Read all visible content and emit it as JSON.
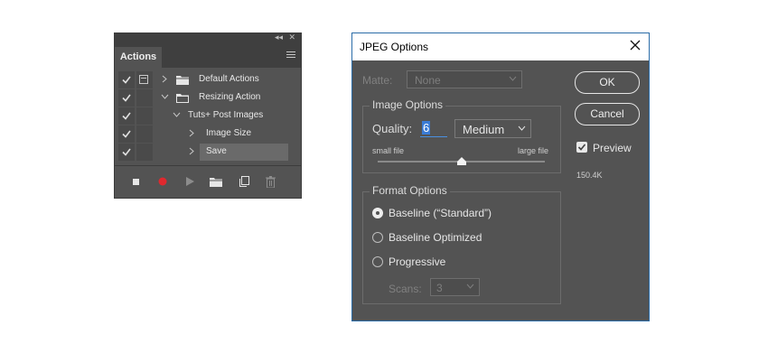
{
  "actions_panel": {
    "tab_label": "Actions",
    "collapse_glyph": "◂◂",
    "close_glyph": "✕",
    "menu_icon": "panel-menu-icon",
    "rows": [
      {
        "label": "Default Actions",
        "checked": true,
        "dialog": true,
        "expanded": false,
        "type": "set"
      },
      {
        "label": "Resizing Action",
        "checked": true,
        "dialog": false,
        "expanded": true,
        "type": "set"
      },
      {
        "label": "Tuts+ Post Images",
        "checked": true,
        "dialog": false,
        "expanded": true,
        "type": "action"
      },
      {
        "label": "Image Size",
        "checked": true,
        "dialog": false,
        "expanded": false,
        "type": "step"
      },
      {
        "label": "Save",
        "checked": true,
        "dialog": false,
        "expanded": false,
        "type": "step",
        "selected": true
      }
    ],
    "bottom_icons": [
      "stop-icon",
      "record-icon",
      "play-icon",
      "new-set-icon",
      "new-action-icon",
      "trash-icon"
    ],
    "record_color": "#e0282e"
  },
  "jpeg_dialog": {
    "title": "JPEG Options",
    "matte": {
      "label": "Matte:",
      "value": "None"
    },
    "image_options": {
      "title": "Image Options",
      "quality_label": "Quality:",
      "quality_value": "6",
      "quality_preset": "Medium",
      "small_file": "small file",
      "large_file": "large file",
      "slider_fraction": 0.5
    },
    "format_options": {
      "title": "Format Options",
      "choices": [
        {
          "label": "Baseline (“Standard”)",
          "selected": true
        },
        {
          "label": "Baseline Optimized",
          "selected": false
        },
        {
          "label": "Progressive",
          "selected": false
        }
      ],
      "scans_label": "Scans:",
      "scans_value": "3"
    },
    "ok_label": "OK",
    "cancel_label": "Cancel",
    "preview_label": "Preview",
    "preview_checked": true,
    "file_size": "150.4K",
    "accent_color": "#2b6ca8"
  }
}
